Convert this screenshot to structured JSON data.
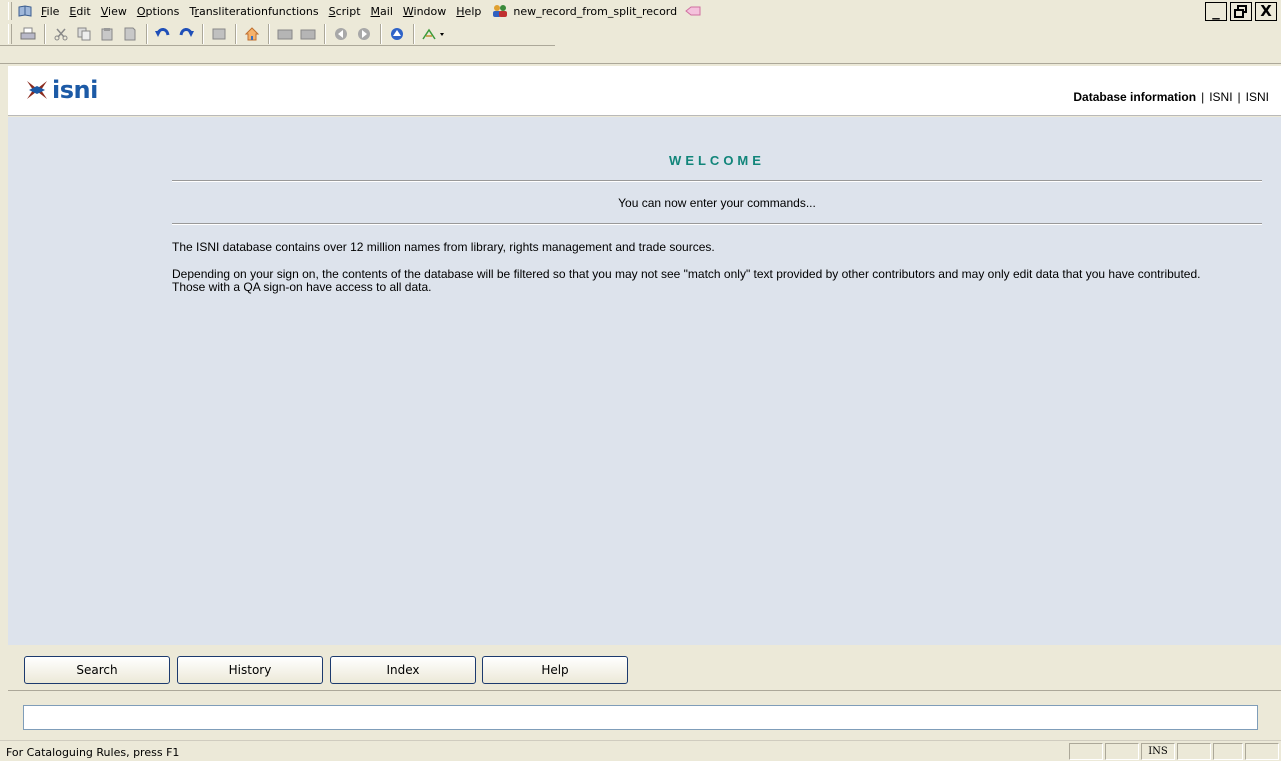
{
  "menu": {
    "items": [
      {
        "label": "File",
        "u": "F",
        "rest": "ile"
      },
      {
        "label": "Edit",
        "u": "E",
        "rest": "dit"
      },
      {
        "label": "View",
        "u": "V",
        "rest": "iew"
      },
      {
        "label": "Options",
        "u": "O",
        "rest": "ptions"
      },
      {
        "label": "Transliterationfunctions",
        "pre": "T",
        "u": "r",
        "rest": "ansliterationfunctions"
      },
      {
        "label": "Script",
        "u": "S",
        "rest": "cript"
      },
      {
        "label": "Mail",
        "u": "M",
        "rest": "ail"
      },
      {
        "label": "Window",
        "u": "W",
        "rest": "indow"
      },
      {
        "label": "Help",
        "u": "H",
        "rest": "elp"
      }
    ],
    "document_title": "new_record_from_split_record"
  },
  "window_buttons": {
    "minimize": "_",
    "restore": "🗗",
    "close": "X"
  },
  "header": {
    "logo_text": "isni",
    "link_database_info": "Database information",
    "separator": "|",
    "link_isni_1": "ISNI",
    "link_isni_2": "ISNI"
  },
  "main": {
    "welcome": "WELCOME",
    "prompt": "You can now enter your commands...",
    "paragraph1": "The ISNI database contains over 12 million names from library, rights management and trade sources.",
    "paragraph2_line1": "Depending on your sign on, the contents of the database will be filtered so that you may not see \"match only\" text provided by other contributors and may only edit data that you have contributed.",
    "paragraph2_line2": "Those with a QA sign-on have access to all data."
  },
  "buttons": {
    "search": "Search",
    "history": "History",
    "index": "Index",
    "help": "Help"
  },
  "command_input": {
    "value": ""
  },
  "status": {
    "text": "For Cataloguing Rules, press F1",
    "panels": [
      "",
      "",
      "INS",
      "",
      "",
      ""
    ]
  },
  "colors": {
    "accent_welcome": "#11857a",
    "logo_blue": "#1c5aa6",
    "main_bg": "#dde3ec",
    "chrome_bg": "#ece9d8"
  }
}
